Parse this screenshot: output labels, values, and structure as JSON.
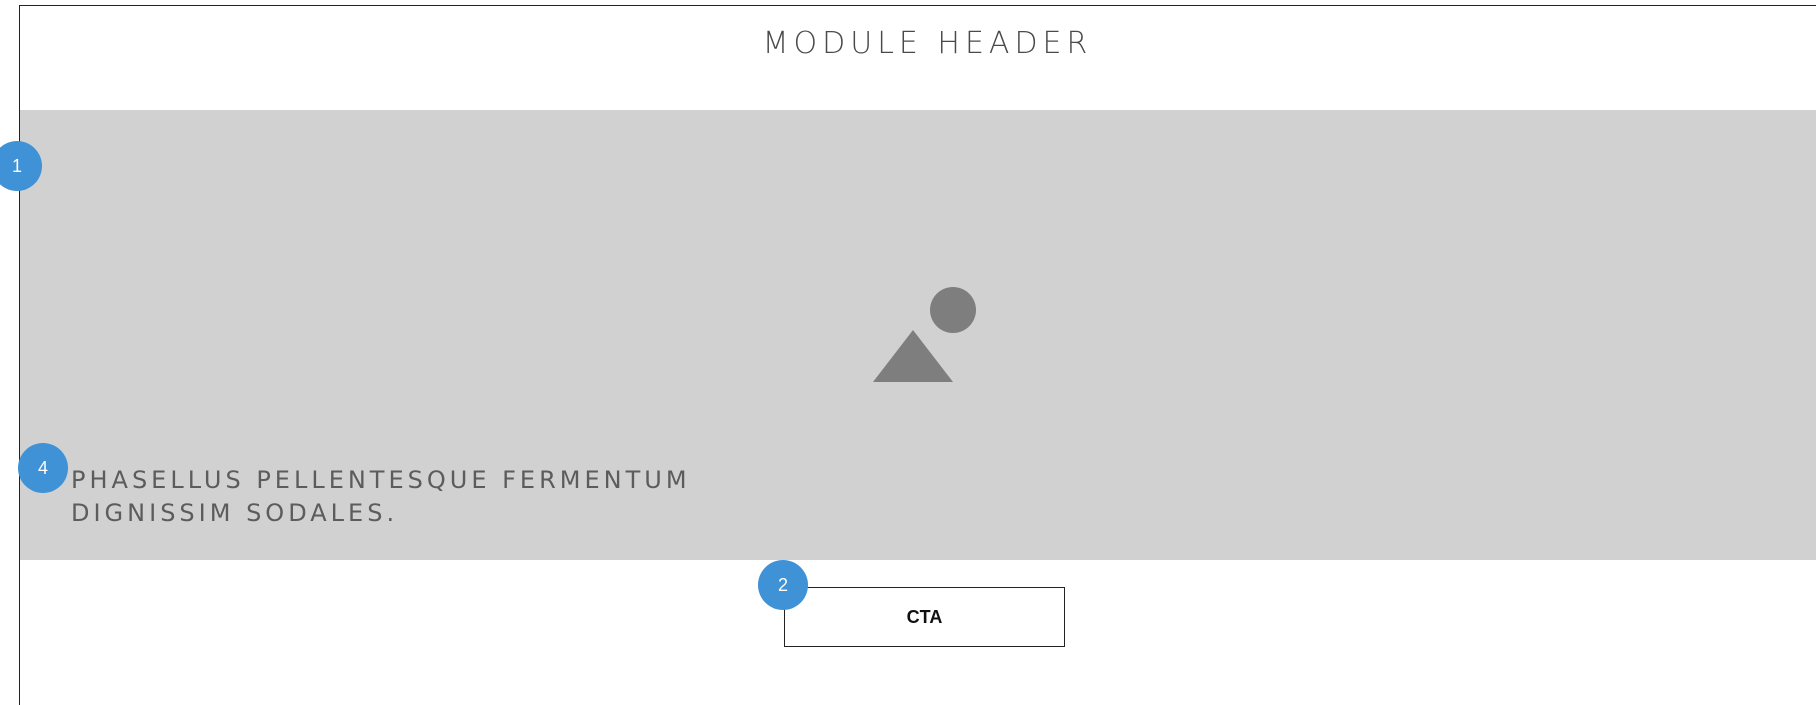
{
  "module": {
    "header": "MODULE HEADER"
  },
  "hero": {
    "image_icon": "image-placeholder-icon",
    "text_line1": "PHASELLUS PELLENTESQUE FERMENTUM",
    "text_line2": "DIGNISSIM SODALES."
  },
  "cta": {
    "label": "CTA"
  },
  "annotations": {
    "badge_1": "1",
    "badge_2": "2",
    "badge_4": "4"
  },
  "colors": {
    "hero_background": "#d1d1d1",
    "placeholder_shape": "#7e7e7e",
    "annotation_badge": "#3f92d6",
    "header_text": "#4a4a4a",
    "hero_text": "#5c5c5c"
  }
}
